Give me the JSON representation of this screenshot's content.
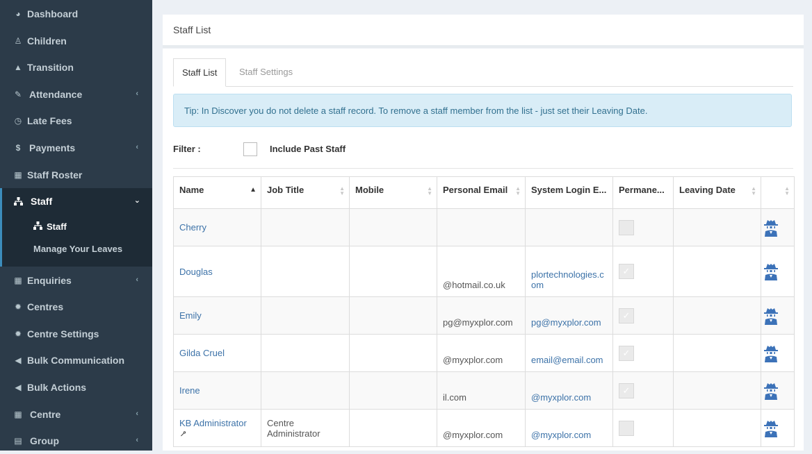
{
  "sidebar": {
    "items": [
      {
        "label": "Dashboard",
        "icon": "dashboard-icon"
      },
      {
        "label": "Children",
        "icon": "child-icon"
      },
      {
        "label": "Transition",
        "icon": "graduation-cap-icon"
      },
      {
        "label": "Attendance",
        "icon": "edit-icon",
        "has_submenu": true
      },
      {
        "label": "Late Fees",
        "icon": "clock-icon"
      },
      {
        "label": "Payments",
        "icon": "dollar-icon",
        "has_submenu": true
      },
      {
        "label": "Staff Roster",
        "icon": "calendar-icon"
      },
      {
        "label": "Staff",
        "icon": "sitemap-icon",
        "expanded": true
      },
      {
        "label": "Enquiries",
        "icon": "th-large-icon",
        "has_submenu": true
      },
      {
        "label": "Centres",
        "icon": "cog-icon"
      },
      {
        "label": "Centre Settings",
        "icon": "cog-icon"
      },
      {
        "label": "Bulk Communication",
        "icon": "bullhorn-icon"
      },
      {
        "label": "Bulk Actions",
        "icon": "bullhorn-icon"
      },
      {
        "label": "Centre",
        "icon": "th-large-icon",
        "has_submenu": true
      },
      {
        "label": "Group",
        "icon": "server-icon",
        "has_submenu": true
      }
    ],
    "staff_submenu": [
      {
        "label": "Staff",
        "icon": "sitemap-icon",
        "active": true
      },
      {
        "label": "Manage Your Leaves"
      }
    ]
  },
  "header": {
    "title": "Staff List"
  },
  "tabs": [
    {
      "label": "Staff List",
      "active": true
    },
    {
      "label": "Staff Settings",
      "active": false
    }
  ],
  "tip": "Tip: In Discover you do not delete a staff record. To remove a staff member from the list - just set their Leaving Date.",
  "filter": {
    "label": "Filter :",
    "include_past_label": "Include Past Staff",
    "include_past_checked": false
  },
  "table": {
    "columns": [
      "Name",
      "Job Title",
      "Mobile",
      "Personal Email",
      "System Login E...",
      "Permane...",
      "Leaving Date",
      ""
    ],
    "rows": [
      {
        "name": "Cherry",
        "job_title": "",
        "mobile": "",
        "personal_email": "",
        "login_email": "",
        "permanent": false,
        "leaving_date": "",
        "linked": false
      },
      {
        "name": "Douglas",
        "job_title": "",
        "mobile": "",
        "personal_email": "@hotmail.co.uk",
        "login_email": "plortechnologies.com",
        "permanent": true,
        "leaving_date": "",
        "linked": false
      },
      {
        "name": "Emily",
        "job_title": "",
        "mobile": "",
        "personal_email": "pg@myxplor.com",
        "login_email": "pg@myxplor.com",
        "permanent": true,
        "leaving_date": "",
        "linked": false
      },
      {
        "name": "Gilda Cruel",
        "job_title": "",
        "mobile": "",
        "personal_email": "@myxplor.com",
        "login_email": "email@email.com",
        "permanent": true,
        "leaving_date": "",
        "linked": false
      },
      {
        "name": "Irene",
        "job_title": "",
        "mobile": "",
        "personal_email": "il.com",
        "login_email": "@myxplor.com",
        "permanent": true,
        "leaving_date": "",
        "linked": false
      },
      {
        "name": "KB Administrator",
        "job_title": "Centre Administrator",
        "mobile": "",
        "personal_email": "@myxplor.com",
        "login_email": "@myxplor.com",
        "permanent": false,
        "leaving_date": "",
        "linked": true
      }
    ]
  },
  "colors": {
    "sidebar": "#2c3b49",
    "sidebar_active": "#1e2b36",
    "accent": "#3c8dbc",
    "link": "#3c72a8",
    "spy_icon": "#3c72b8"
  }
}
